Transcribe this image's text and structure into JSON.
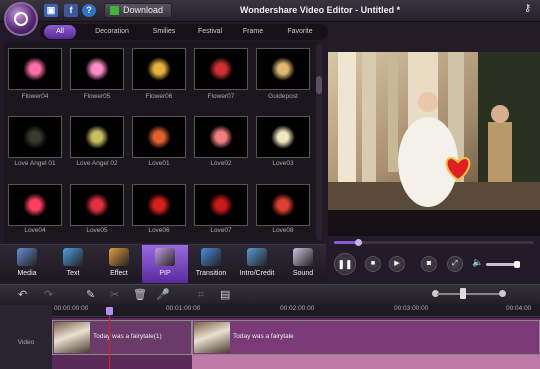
{
  "app": {
    "title": "Wondershare Video Editor - Untitled *",
    "download_label": "Download"
  },
  "filter_tabs": [
    {
      "label": "All",
      "active": true
    },
    {
      "label": "Decoration",
      "active": false
    },
    {
      "label": "Smilies",
      "active": false
    },
    {
      "label": "Festival",
      "active": false
    },
    {
      "label": "Frame",
      "active": false
    },
    {
      "label": "Favorite",
      "active": false
    }
  ],
  "effects": [
    {
      "label": "Flower04",
      "icon": "flower-sparkle-icon",
      "color": "#ff6fa8"
    },
    {
      "label": "Flower05",
      "icon": "flower-pink-icon",
      "color": "#ff8ac8"
    },
    {
      "label": "Flower06",
      "icon": "flower-gold-icon",
      "color": "#e8b040"
    },
    {
      "label": "Flower07",
      "icon": "flower-red-icon",
      "color": "#d03030"
    },
    {
      "label": "Guidepost",
      "icon": "signpost-icon",
      "color": "#e0b870"
    },
    {
      "label": "Love Angel 01",
      "icon": "angel-icon",
      "color": "#3a3a30"
    },
    {
      "label": "Love Angel 02",
      "icon": "angel-gold-icon",
      "color": "#c8c060"
    },
    {
      "label": "Love01",
      "icon": "hearts-icon",
      "color": "#e06030"
    },
    {
      "label": "Love02",
      "icon": "heart-bouquet-icon",
      "color": "#f08080"
    },
    {
      "label": "Love03",
      "icon": "heart-cake-icon",
      "color": "#f0e8c0"
    },
    {
      "label": "Love04",
      "icon": "love-text-icon",
      "color": "#ff4060"
    },
    {
      "label": "Love05",
      "icon": "love-cards-icon",
      "color": "#e03040"
    },
    {
      "label": "Love06",
      "icon": "red-rose-icon",
      "color": "#d82020"
    },
    {
      "label": "Love07",
      "icon": "roses-icon",
      "color": "#c81818"
    },
    {
      "label": "Love08",
      "icon": "heart-frame-icon",
      "color": "#e04030"
    }
  ],
  "categories": [
    {
      "label": "Media",
      "icon": "film-icon",
      "color": "#6a8ad0",
      "active": false
    },
    {
      "label": "Text",
      "icon": "text-icon",
      "color": "#4aa0e0",
      "active": false
    },
    {
      "label": "Effect",
      "icon": "effect-icon",
      "color": "#e0a040",
      "active": false
    },
    {
      "label": "PIP",
      "icon": "pip-icon",
      "color": "#c0a0e0",
      "active": true
    },
    {
      "label": "Transition",
      "icon": "transition-icon",
      "color": "#4a8ae0",
      "active": false
    },
    {
      "label": "Intro/Credit",
      "icon": "intro-credit-icon",
      "color": "#5a9ad0",
      "active": false
    },
    {
      "label": "Sound",
      "icon": "sound-icon",
      "color": "#d0c0e0",
      "active": false
    }
  ],
  "player": {
    "progress": 0.12,
    "volume": 0.9
  },
  "timeline": {
    "zoom": 0.4,
    "ruler": [
      "00:00:00:00",
      "00:01:00:00",
      "00:02:00:00",
      "00:03:00:00",
      "00:04:00"
    ],
    "track_label": "Video",
    "clips": [
      {
        "label": "Today was a fairytale(1)"
      },
      {
        "label": "Today was a fairytale"
      }
    ]
  },
  "colors": {
    "accent": "#8a5ad0",
    "track": "#5a2a58",
    "audio": "#c07aa8",
    "playhead": "#e02020"
  }
}
